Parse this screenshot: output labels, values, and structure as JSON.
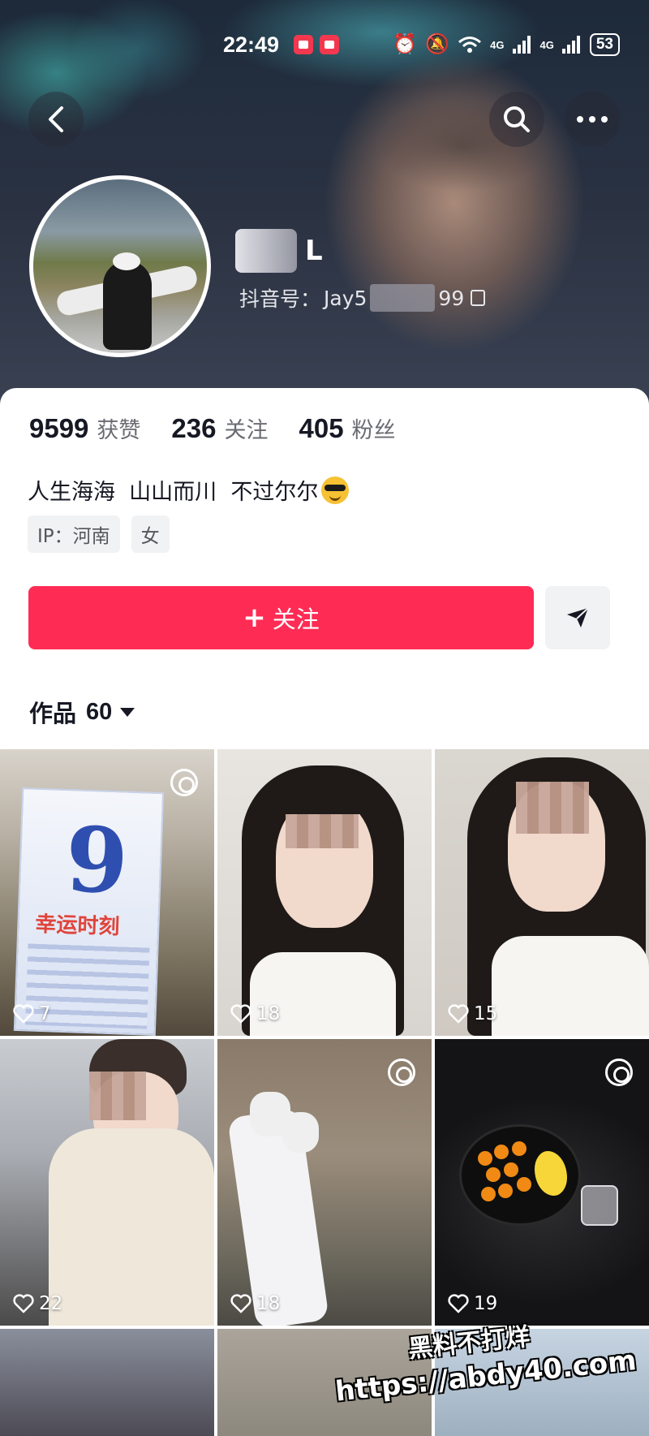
{
  "status_bar": {
    "time": "22:49",
    "battery": "53",
    "network_labels": [
      "4G",
      "4G"
    ]
  },
  "header": {
    "back_icon": "chevron-left-icon",
    "search_icon": "search-icon",
    "more_icon": "more-horizontal-icon"
  },
  "profile": {
    "nickname_suffix": "L",
    "douyin_id_label": "抖音号：",
    "douyin_id_prefix": "Jay5",
    "douyin_id_suffix": "99"
  },
  "stats": [
    {
      "value": "9599",
      "label": "获赞"
    },
    {
      "value": "236",
      "label": "关注"
    },
    {
      "value": "405",
      "label": "粉丝"
    }
  ],
  "bio": "人生海海  山山而川  不过尔尔",
  "tags": [
    "IP：河南",
    "女"
  ],
  "actions": {
    "follow_plus": "+",
    "follow_label": "关注",
    "share_icon": "paper-plane-icon"
  },
  "works": {
    "title": "作品",
    "count": "60"
  },
  "grid": {
    "likes": [
      "7",
      "18",
      "15",
      "22",
      "18",
      "19"
    ],
    "ticket_title": "幸运时刻",
    "ticket_number": "9"
  },
  "watermark": {
    "line1": "黑料不打烊",
    "line2": "https://abdy40.com"
  },
  "colors": {
    "follow_button": "#fe2c55",
    "text_primary": "#161823",
    "text_secondary": "#6a6b72"
  }
}
